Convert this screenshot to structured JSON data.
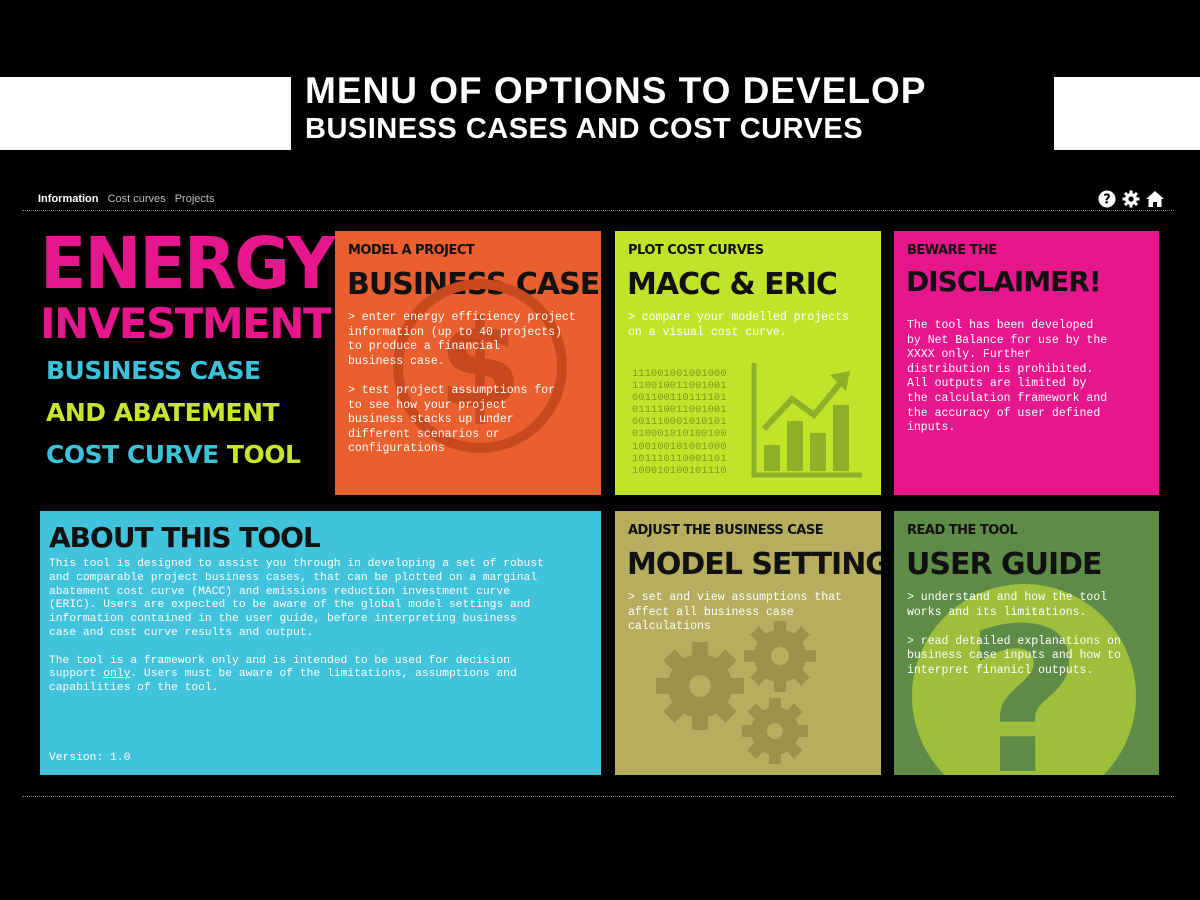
{
  "banner": {
    "line1": "MENU OF OPTIONS TO DEVELOP",
    "line2": "BUSINESS CASES AND COST CURVES"
  },
  "nav": {
    "items": [
      "Information",
      "Cost curves",
      "Projects"
    ],
    "active": "Information"
  },
  "toolbar_icons": [
    "help-icon",
    "settings-gear-icon",
    "home-icon"
  ],
  "logo": {
    "line1": "ENERGY",
    "line2": "INVESTMENT",
    "line3": "BUSINESS CASE",
    "line4": "AND ABATEMENT",
    "line5a": "COST CURVE",
    "line5b": "TOOL"
  },
  "tiles": {
    "business_case": {
      "kicker": "MODEL A PROJECT",
      "heading": "BUSINESS CASE",
      "body": "> enter energy efficiency project\ninformation (up to 40 projects)\nto produce a financial\nbusiness case.\n\n> test project assumptions for\nto see how your project\nbusiness stacks up under\ndifferent scenarios or\nconfigurations",
      "color": "#e95f2d",
      "icon": "dollar-coin-icon"
    },
    "macc": {
      "kicker": "PLOT COST CURVES",
      "heading": "MACC & ERIC",
      "body": "> compare your modelled projects\non a visual cost curve.",
      "binary": "111001001001000\n110010011001001\n001100110111101\n011110011001001\n001110001010101\n010001010100100\n100100101001000\n101110110001101\n100010100101110",
      "color": "#c1e42a",
      "icon": "growth-chart-icon"
    },
    "disclaimer": {
      "kicker": "BEWARE THE",
      "heading": "DISCLAIMER!",
      "body": "The tool has been developed\nby Net Balance for use by the\nXXXX only. Further\ndistribution is prohibited.\nAll outputs are limited by\nthe calculation framework and\nthe accuracy of user defined\ninputs.",
      "color": "#e6168c"
    },
    "about": {
      "heading": "ABOUT THIS TOOL",
      "body_p1": "This tool is designed to assist you through in developing a set of robust\nand comparable project business cases, that can be plotted on a marginal\nabatement cost curve (MACC) and emissions reduction investment curve\n(ERIC). Users are expected to be aware of the global model settings and\ninformation contained in the user guide, before interpreting business\ncase and cost curve results and output.",
      "body_p2_a": "The tool is a framework only and is intended to be used for decision\nsupport ",
      "body_p2_underline": "only",
      "body_p2_b": ". Users must be aware of the limitations, assumptions and\ncapabilities of the tool.",
      "version": "Version: 1.0",
      "color": "#41c3dc"
    },
    "settings": {
      "kicker": "ADJUST THE BUSINESS CASE",
      "heading": "MODEL SETTINGS",
      "body": "> set and view assumptions that\naffect all business case\ncalculations",
      "color": "#b6ad5f",
      "icon": "gears-icon"
    },
    "guide": {
      "kicker": "READ THE TOOL",
      "heading": "USER GUIDE",
      "body": "> understand and how the tool\nworks and its limitations.\n\n> read detailed explanations on\nbusiness case inputs and how to\ninterpret finanicl outputs.",
      "color": "#5e8c46",
      "icon": "question-mark-icon"
    }
  }
}
